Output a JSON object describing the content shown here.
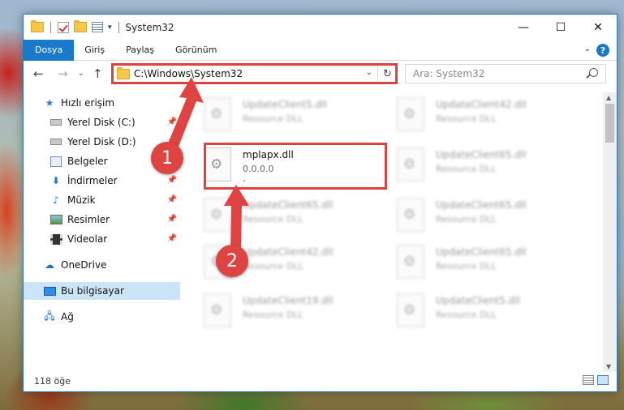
{
  "window": {
    "title": "System32",
    "controls": {
      "minimize": "—",
      "maximize": "☐",
      "close": "✕"
    }
  },
  "ribbon": {
    "tabs": [
      "Dosya",
      "Giriş",
      "Paylaş",
      "Görünüm"
    ],
    "help": "?"
  },
  "address": {
    "path": "C:\\Windows\\System32",
    "search_placeholder": "Ara: System32"
  },
  "sidebar": {
    "items": [
      {
        "label": "Hızlı erişim",
        "icon": "star-icon",
        "pinned": false
      },
      {
        "label": "Yerel Disk (C:)",
        "icon": "drive-icon",
        "pinned": true
      },
      {
        "label": "Yerel Disk (D:)",
        "icon": "drive-icon",
        "pinned": true
      },
      {
        "label": "Belgeler",
        "icon": "documents-icon",
        "pinned": true
      },
      {
        "label": "İndirmeler",
        "icon": "download-icon",
        "pinned": true
      },
      {
        "label": "Müzik",
        "icon": "music-icon",
        "pinned": true
      },
      {
        "label": "Resimler",
        "icon": "pictures-icon",
        "pinned": true
      },
      {
        "label": "Videolar",
        "icon": "videos-icon",
        "pinned": true
      },
      {
        "label": "OneDrive",
        "icon": "cloud-icon",
        "pinned": false
      },
      {
        "label": "Bu bilgisayar",
        "icon": "computer-icon",
        "pinned": false,
        "selected": true
      },
      {
        "label": "Ağ",
        "icon": "network-icon",
        "pinned": false
      }
    ]
  },
  "files": {
    "left_column": [
      {
        "name": "UpdateClient5.dll",
        "type": "Resource DLL"
      },
      {
        "name": "mplapx.dll",
        "type": "0.0.0.0",
        "extra": "-"
      },
      {
        "name": "UpdateClient65.dll",
        "type": "Resource DLL"
      },
      {
        "name": "UpdateClient42.dll",
        "type": "Resource DLL"
      },
      {
        "name": "UpdateClient19.dll",
        "type": "Resource DLL"
      }
    ],
    "right_column": [
      {
        "name": "UpdateClient42.dll",
        "type": "Resource DLL"
      },
      {
        "name": "UpdateClient65.dll",
        "type": "Resource DLL"
      },
      {
        "name": "UpdateClient65.dll",
        "type": "Resource DLL"
      },
      {
        "name": "UpdateClient65.dll",
        "type": "Resource DLL"
      },
      {
        "name": "UpdateClient5.dll",
        "type": "Resource DLL"
      }
    ]
  },
  "status": {
    "count": "118 öğe"
  },
  "callouts": {
    "step1": "1",
    "step2": "2"
  },
  "colors": {
    "accent": "#1979ca",
    "highlight": "#e0403f",
    "selected_nav": "#cce4f7"
  }
}
